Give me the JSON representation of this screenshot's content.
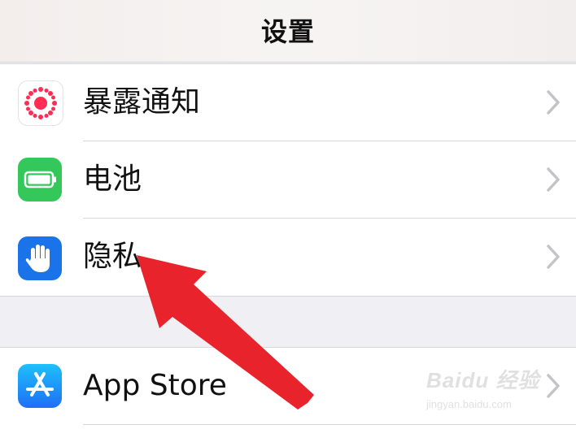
{
  "nav": {
    "title": "设置"
  },
  "settings": {
    "items": [
      {
        "label": "暴露通知",
        "icon": "exposure-notification-icon",
        "icon_color": "#ffffff",
        "accent": "#ff2d55"
      },
      {
        "label": "电池",
        "icon": "battery-icon",
        "icon_color": "#34c759"
      },
      {
        "label": "隐私",
        "icon": "privacy-hand-icon",
        "icon_color": "#1a73e8"
      },
      {
        "label": "App Store",
        "icon": "app-store-icon",
        "icon_color": "#1e8cf5"
      }
    ],
    "chevron_icon": "chevron-right-icon"
  },
  "annotation": {
    "arrow_color": "#e8232b",
    "points_to": "隐私"
  },
  "watermark": {
    "brand": "Baidu 经验",
    "url": "jingyan.baidu.com"
  },
  "colors": {
    "background": "#efeff4",
    "cell": "#ffffff",
    "separator": "#d8d8dc",
    "chevron": "#c4c4c8"
  }
}
